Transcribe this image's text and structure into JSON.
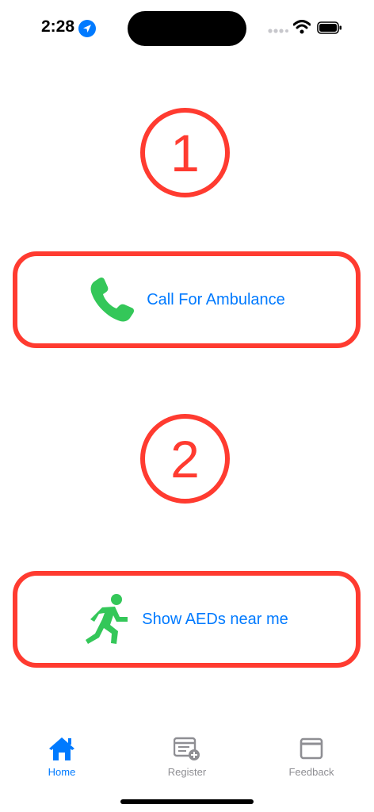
{
  "status_bar": {
    "time": "2:28"
  },
  "steps": [
    {
      "number": "1"
    },
    {
      "number": "2"
    }
  ],
  "actions": {
    "ambulance": {
      "label": "Call For Ambulance",
      "icon": "phone-icon"
    },
    "aed": {
      "label": "Show AEDs near me",
      "icon": "running-person-icon"
    }
  },
  "tab_bar": {
    "items": [
      {
        "label": "Home",
        "icon": "house-icon",
        "active": true
      },
      {
        "label": "Register",
        "icon": "register-icon",
        "active": false
      },
      {
        "label": "Feedback",
        "icon": "window-icon",
        "active": false
      }
    ]
  },
  "colors": {
    "accent": "#007aff",
    "alert_red": "#ff3b30",
    "icon_green": "#34c759",
    "inactive_gray": "#8e8e93"
  }
}
